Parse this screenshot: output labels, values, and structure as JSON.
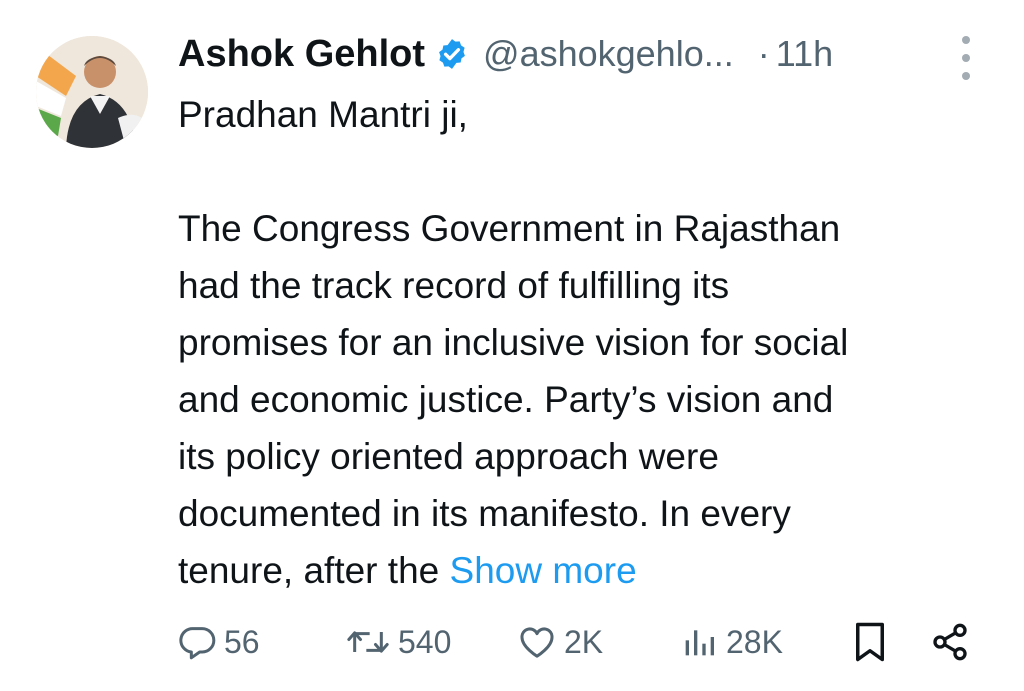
{
  "author": {
    "name": "Ashok Gehlot",
    "handle": "@ashokgehlo...",
    "time": "11h",
    "separator": "·",
    "verified_color": "#1d9bf0"
  },
  "tweet": {
    "greeting": "Pradhan Mantri ji,",
    "lines": [
      "The Congress Government in Rajasthan",
      "had the track record of fulfilling its",
      "promises for an inclusive vision for social",
      "and economic justice. Party’s vision and",
      "its policy oriented approach were",
      "documented in its manifesto. In every"
    ],
    "last_line": "tenure, after the ",
    "show_more": "Show more"
  },
  "actions": {
    "replies": "56",
    "retweets": "540",
    "likes": "2K",
    "views": "28K"
  },
  "icons": {
    "verified": "verified-badge-icon",
    "more": "more-options-icon",
    "reply": "reply-icon",
    "retweet": "retweet-icon",
    "like": "like-icon",
    "views": "views-icon",
    "bookmark": "bookmark-icon",
    "share": "share-icon"
  },
  "colors": {
    "text": "#0f1419",
    "muted": "#536471",
    "link": "#1d9bf0"
  }
}
